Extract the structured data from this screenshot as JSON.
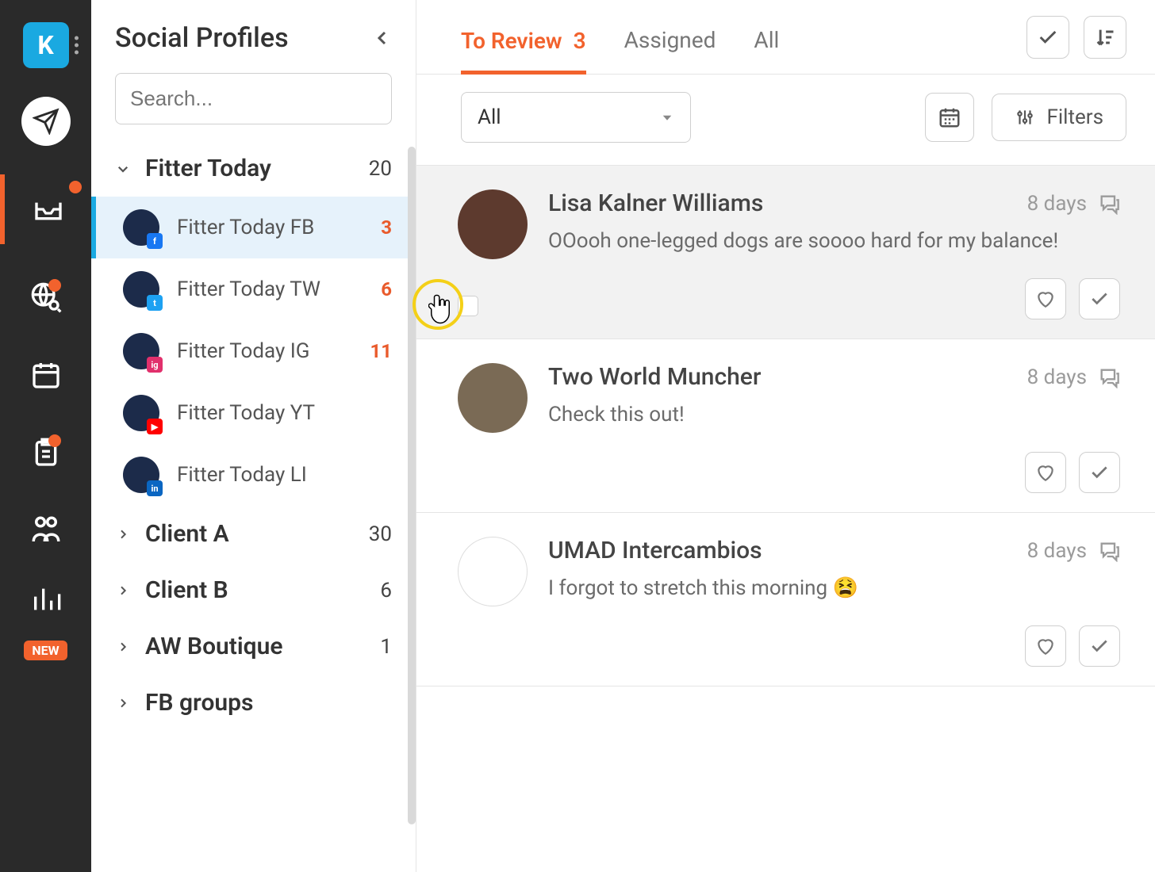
{
  "brand_letter": "K",
  "new_badge": "NEW",
  "sidebar": {
    "title": "Social Profiles",
    "search_placeholder": "Search...",
    "groups": [
      {
        "name": "Fitter Today",
        "count": "20",
        "expanded": true,
        "profiles": [
          {
            "name": "Fitter Today FB",
            "count": "3",
            "network": "fb"
          },
          {
            "name": "Fitter Today TW",
            "count": "6",
            "network": "tw"
          },
          {
            "name": "Fitter Today IG",
            "count": "11",
            "network": "ig"
          },
          {
            "name": "Fitter Today YT",
            "count": "",
            "network": "yt"
          },
          {
            "name": "Fitter Today LI",
            "count": "",
            "network": "li"
          }
        ]
      },
      {
        "name": "Client A",
        "count": "30",
        "expanded": false
      },
      {
        "name": "Client B",
        "count": "6",
        "expanded": false
      },
      {
        "name": "AW Boutique",
        "count": "1",
        "expanded": false
      },
      {
        "name": "FB groups",
        "count": "",
        "expanded": false
      }
    ]
  },
  "tabs": {
    "to_review": "To Review",
    "to_review_count": "3",
    "assigned": "Assigned",
    "all": "All"
  },
  "filters": {
    "dropdown_value": "All",
    "filters_label": "Filters"
  },
  "feed": [
    {
      "name": "Lisa Kalner Williams",
      "age": "8 days",
      "text": "OOooh one-legged dogs are soooo hard for my balance!"
    },
    {
      "name": "Two World Muncher",
      "age": "8 days",
      "text": "Check this out!"
    },
    {
      "name": "UMAD Intercambios",
      "age": "8 days",
      "text": "I forgot to stretch this morning 😫"
    }
  ]
}
